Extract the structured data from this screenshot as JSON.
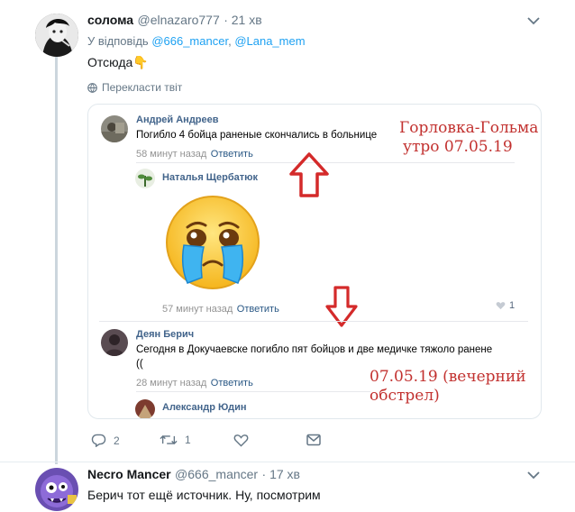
{
  "tweet1": {
    "name": "солома",
    "handle": "@elnazaro777",
    "time": "· 21 хв",
    "reply_prefix": "У відповідь",
    "reply_to_1": "@666_mancer",
    "reply_sep": ",",
    "reply_to_2": "@Lana_mem",
    "text": "Отсюда",
    "text_emoji": "👇",
    "translate": "Перекласти твіт",
    "replies": "2",
    "retweets": "1"
  },
  "vk": {
    "c1_name": "Андрей Андреев",
    "c1_text": "Погибло 4 бойца раненые скончались в больнице",
    "c1_time": "58 минут назад",
    "c1_reply": "Ответить",
    "c2_name": "Наталья Щербатюк",
    "c2_time": "57 минут назад",
    "c2_reply": "Ответить",
    "c2_likes": "1",
    "c3_name": "Деян Берич",
    "c3_text_1": "Сегодня в Докучаевске погибло пят бойцов и две медичке тяжоло ранене",
    "c3_text_2": "((",
    "c3_time": "28 минут назад",
    "c3_reply": "Ответить",
    "c4_name": "Александр Юдин",
    "note1_line1": "Горловка-Гольма",
    "note1_line2": "утро 07.05.19",
    "note2_line1": "07.05.19 (вечерний",
    "note2_line2": "обстрел)",
    "accent_red": "#d42a2a"
  },
  "tweet2": {
    "name": "Necro Mancer",
    "handle": "@666_mancer",
    "time": "· 17 хв",
    "text": "Берич тот ещё источник. Ну, посмотрим"
  },
  "colors": {
    "link": "#1da1f2",
    "muted": "#657786",
    "vk_name": "#42648b"
  }
}
